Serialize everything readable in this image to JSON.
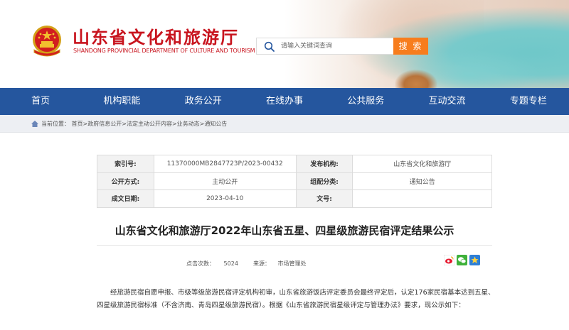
{
  "header": {
    "title": "山东省文化和旅游厅",
    "subtitle": "SHANDONG PROVINCIAL DEPARTMENT OF CULTURE AND TOURISM",
    "search": {
      "placeholder": "请输入关键词查询",
      "button_label": "搜 索"
    },
    "colors": {
      "brand_red": "#c8141e",
      "search_orange": "#f77d1d"
    }
  },
  "nav": {
    "items": [
      "首页",
      "机构职能",
      "政务公开",
      "在线办事",
      "公共服务",
      "互动交流",
      "专题专栏"
    ],
    "color": "#25569e"
  },
  "breadcrumb": {
    "text": "当前位置： 首页>政府信息公开>法定主动公开内容>业务动态>通知公告"
  },
  "info": {
    "index_label": "索引号:",
    "index_value": "11370000MB2847723P/2023-00432",
    "issuer_label": "发布机构:",
    "issuer_value": "山东省文化和旅游厅",
    "publicity_label": "公开方式:",
    "publicity_value": "主动公开",
    "category_label": "组配分类:",
    "category_value": "通知公告",
    "date_label": "成文日期:",
    "date_value": "2023-04-10",
    "docno_label": "文号:",
    "docno_value": ""
  },
  "article": {
    "title": "山东省文化和旅游厅2022年山东省五星、四星级旅游民宿评定结果公示",
    "clicks_label": "点击次数：",
    "clicks_value": "5024",
    "source_label": "来源：",
    "source_value": "市场管理处",
    "share_icons": [
      "weibo-icon",
      "wechat-icon",
      "favorite-icon"
    ],
    "body": "经旅游民宿自愿申报、市级等级旅游民宿评定机构初审，山东省旅游饭店评定委员会最终评定后，认定176家民宿基本达到五星、四星级旅游民宿标准（不含济南、青岛四星级旅游民宿）。根据《山东省旅游民宿星级评定与管理办法》要求，现公示如下："
  }
}
